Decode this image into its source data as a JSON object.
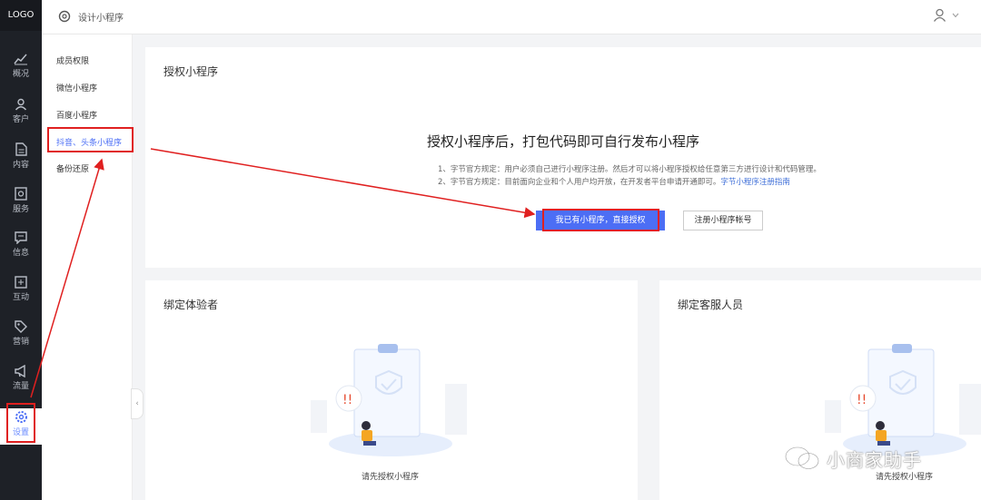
{
  "rail": {
    "logo": "LOGO",
    "items": [
      {
        "label": "概况",
        "icon": "chart-icon"
      },
      {
        "label": "客户",
        "icon": "user-icon"
      },
      {
        "label": "内容",
        "icon": "document-icon"
      },
      {
        "label": "服务",
        "icon": "service-icon"
      },
      {
        "label": "信息",
        "icon": "message-icon"
      },
      {
        "label": "互动",
        "icon": "interaction-icon"
      },
      {
        "label": "营销",
        "icon": "tag-icon"
      },
      {
        "label": "流量",
        "icon": "megaphone-icon"
      },
      {
        "label": "设置",
        "icon": "gear-icon"
      }
    ]
  },
  "header": {
    "title": "设计小程序"
  },
  "submenu": {
    "items": [
      "成员权限",
      "微信小程序",
      "百度小程序",
      "抖音、头条小程序",
      "备份还原"
    ]
  },
  "auth": {
    "title": "授权小程序",
    "headline": "授权小程序后，打包代码即可自行发布小程序",
    "rule1": "1、字节官方规定：用户必须自己进行小程序注册。然后才可以将小程序授权给任意第三方进行设计和代码管理。",
    "rule2": "2、字节官方规定：目前面向企业和个人用户均开放，在开发者平台申请开通即可。",
    "rule2_link": "字节小程序注册指南",
    "primary_button": "我已有小程序，直接授权",
    "secondary_button": "注册小程序帐号"
  },
  "tester": {
    "title": "绑定体验者",
    "empty": "请先授权小程序"
  },
  "cs": {
    "title": "绑定客服人员",
    "empty": "请先授权小程序"
  },
  "watermark": "小商家助手",
  "colors": {
    "accent": "#4c6ef5",
    "annotation": "#e02020",
    "rail_bg": "#1e2127"
  }
}
